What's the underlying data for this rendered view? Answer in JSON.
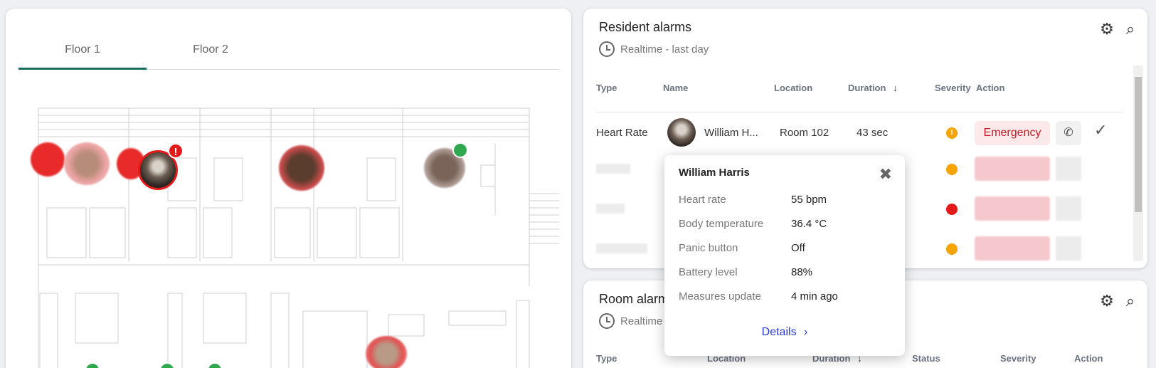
{
  "floor": {
    "tabs": [
      {
        "label": "Floor 1",
        "active": true
      },
      {
        "label": "Floor 2",
        "active": false
      }
    ]
  },
  "resident_alarms": {
    "title": "Resident alarms",
    "subtitle": "Realtime - last day",
    "columns": [
      "Type",
      "Name",
      "Location",
      "Duration",
      "Severity",
      "Action"
    ],
    "sort_column": "Duration",
    "rows": [
      {
        "type": "Heart Rate",
        "name": "William H...",
        "location": "Room 102",
        "duration": "43 sec",
        "severity": "warning",
        "action": "Emergency"
      }
    ]
  },
  "room_alarms": {
    "title": "Room alarm",
    "subtitle": "Realtime",
    "columns": [
      "Type",
      "Location",
      "Duration",
      "Status",
      "Severity",
      "Action"
    ]
  },
  "popover": {
    "name": "William Harris",
    "fields": [
      {
        "label": "Heart rate",
        "value": "55 bpm"
      },
      {
        "label": "Body temperature",
        "value": "36.4 °C"
      },
      {
        "label": "Panic button",
        "value": "Off"
      },
      {
        "label": "Battery level",
        "value": "88%"
      },
      {
        "label": "Measures update",
        "value": "4 min ago"
      }
    ],
    "details_label": "Details"
  },
  "colors": {
    "accent": "#1c6e5c",
    "alarm_red": "#e31a1a",
    "link": "#2b3bd6"
  },
  "icons": [
    "clock-icon",
    "gear-icon",
    "search-icon",
    "phone-icon",
    "check-icon",
    "close-icon",
    "chevron-right-icon"
  ]
}
